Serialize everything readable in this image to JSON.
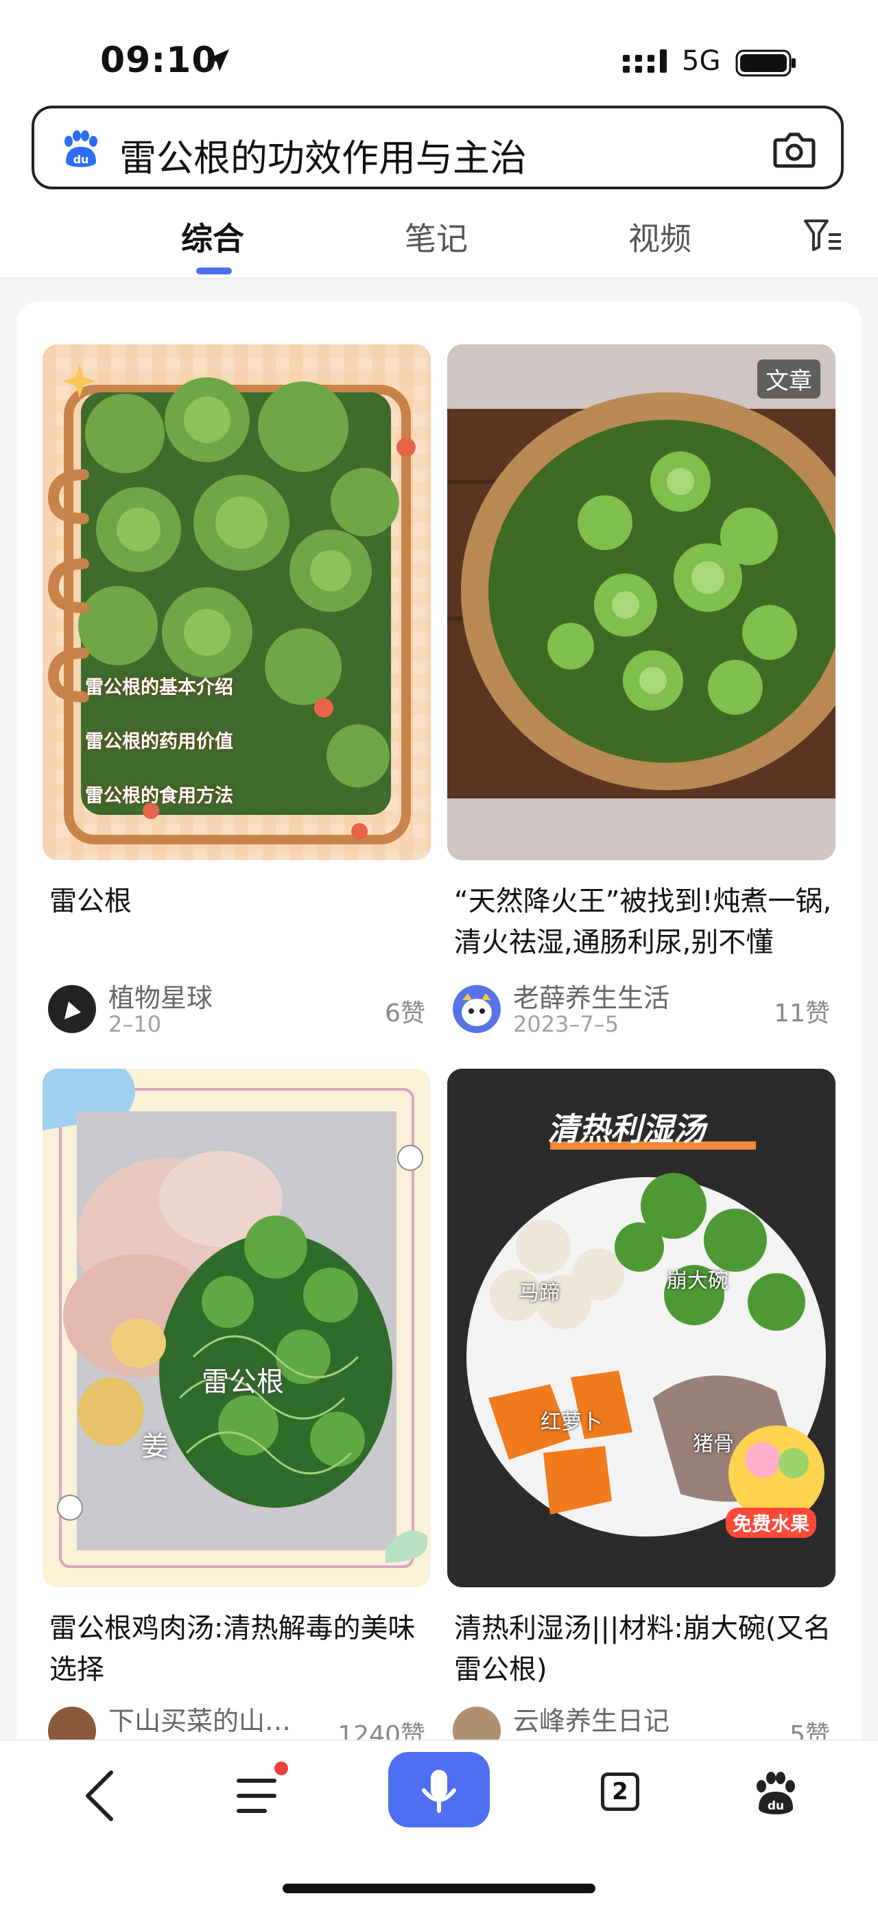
{
  "status_bar": {
    "time": "09:10",
    "network": "5G"
  },
  "search": {
    "query": "雷公根的功效作用与主治"
  },
  "tabs": [
    {
      "label": "综合",
      "active": true
    },
    {
      "label": "笔记",
      "active": false
    },
    {
      "label": "视频",
      "active": false
    }
  ],
  "cards": [
    {
      "title": "雷公根",
      "image_lines": [
        "雷公根的基本介绍",
        "雷公根的药用价值",
        "雷公根的食用方法"
      ],
      "author": "植物星球",
      "date": "2–10",
      "likes": "6赞"
    },
    {
      "badge": "文章",
      "title": "“天然降火王”被找到!炖煮一锅,清火祛湿,通肠利尿,别不懂",
      "author": "老薛养生生活",
      "date": "2023–7–5",
      "likes": "11赞"
    },
    {
      "title": "雷公根鸡肉汤:清热解毒的美味选择",
      "image_labels": [
        "雷公根",
        "姜"
      ],
      "author": "下山买菜的山…",
      "likes": "1240赞"
    },
    {
      "title": "清热利湿汤|||材料:崩大碗(又名雷公根)",
      "image_title": "清热利湿汤",
      "image_labels": [
        "马蹄",
        "崩大碗",
        "红萝卜",
        "猪骨"
      ],
      "promo": "免费水果",
      "author": "云峰养生日记",
      "likes": "5赞"
    }
  ],
  "bottom_nav": {
    "tab_count": "2"
  },
  "colors": {
    "accent": "#4e6ef2",
    "notification": "#f23d3d"
  },
  "icons": [
    "location-arrow-icon",
    "signal-icon",
    "battery-icon",
    "baidu-paw-icon",
    "camera-icon",
    "filter-icon",
    "back-icon",
    "menu-icon",
    "microphone-icon",
    "tabs-icon"
  ]
}
